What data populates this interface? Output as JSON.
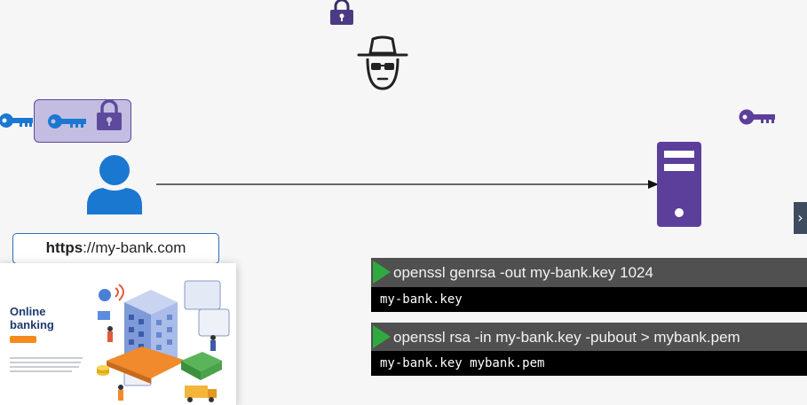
{
  "icons": {
    "top_lock": "padlock-icon",
    "hacker": "hacker-icon",
    "client_key": "key-icon",
    "box_key": "key-icon",
    "box_lock": "padlock-icon",
    "user": "user-icon",
    "server": "server-icon",
    "server_key": "key-icon",
    "next": "chevron-right-icon"
  },
  "colors": {
    "user_blue": "#1a78d0",
    "key_purple": "#5b3f9a",
    "lock_purple": "#5e4a9c",
    "box_fill": "#c3bde2",
    "terminal_header": "#505050",
    "terminal_output": "#000000",
    "play_green": "#2faa3f"
  },
  "url_bar": {
    "scheme": "https",
    "rest": "://my-bank.com"
  },
  "bank_card": {
    "title": "Online banking"
  },
  "nav": {
    "next_glyph": "›"
  },
  "terminals": [
    {
      "command": "openssl genrsa -out my-bank.key 1024",
      "output": "my-bank.key"
    },
    {
      "command": "openssl rsa -in my-bank.key -pubout > mybank.pem",
      "output": "my-bank.key mybank.pem"
    }
  ]
}
